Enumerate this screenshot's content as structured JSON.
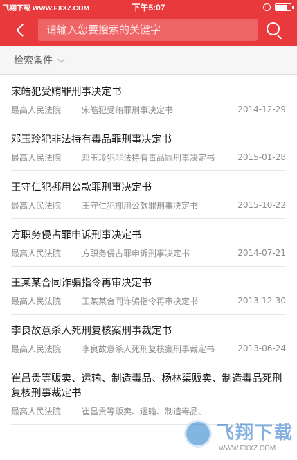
{
  "status_bar": {
    "carrier": "飞翔下载 WWW.FXXZ.COM",
    "time": "下午5:07"
  },
  "header": {
    "search_placeholder": "请输入您要搜索的关键字"
  },
  "filter": {
    "label": "检索条件"
  },
  "results": [
    {
      "title": "宋皓犯受贿罪刑事决定书",
      "court": "最高人民法院",
      "doc": "宋皓犯受贿罪刑事决定书",
      "date": "2014-12-29"
    },
    {
      "title": "邓玉玲犯非法持有毒品罪刑事决定书",
      "court": "最高人民法院",
      "doc": "邓玉玲犯非法持有毒品罪刑事决定书",
      "date": "2015-01-28"
    },
    {
      "title": "王守仁犯挪用公款罪刑事决定书",
      "court": "最高人民法院",
      "doc": "王守仁犯挪用公款罪刑事决定书",
      "date": "2015-10-22"
    },
    {
      "title": "方职务侵占罪申诉刑事决定书",
      "court": "最高人民法院",
      "doc": "方职务侵占罪申诉刑事决定书",
      "date": "2014-07-21"
    },
    {
      "title": "王某某合同诈骗指令再审决定书",
      "court": "最高人民法院",
      "doc": "王某某合同诈骗指令再审决定书",
      "date": "2013-12-30"
    },
    {
      "title": "李良故意杀人死刑复核案刑事裁定书",
      "court": "最高人民法院",
      "doc": "李良故意杀人死刑复核案刑事裁定书",
      "date": "2013-06-24"
    },
    {
      "title": "崔昌贵等贩卖、运输、制造毒品、杨林渠贩卖、制造毒品死刑复核刑事裁定书",
      "court": "最高人民法院",
      "doc": "崔昌贵等贩卖、运输、制造毒品、",
      "date": ""
    }
  ],
  "watermark": {
    "text": "飞翔下载",
    "url": "WWW.FXXZ.COM"
  }
}
